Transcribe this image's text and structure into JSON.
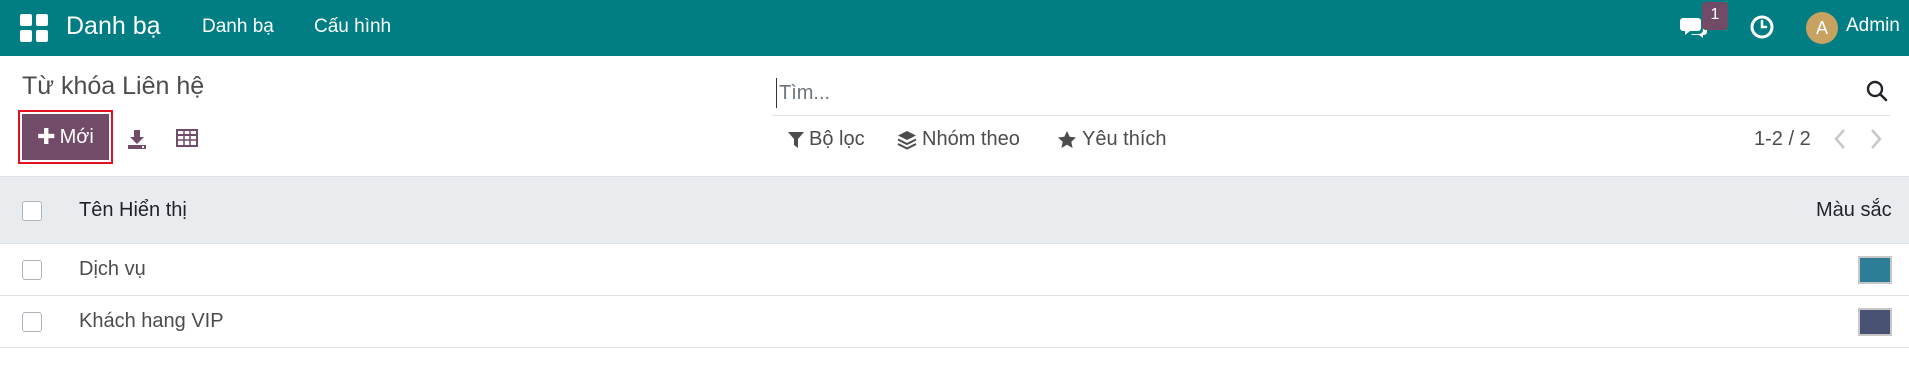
{
  "navbar": {
    "brand": "Danh bạ",
    "menus": [
      "Danh bạ",
      "Cấu hình"
    ],
    "message_count": "1",
    "avatar_letter": "A",
    "user": "Admin",
    "bg_color": "#017e84"
  },
  "control_panel": {
    "title": "Từ khóa Liên hệ",
    "new_label": "Mới",
    "search_placeholder": "Tìm...",
    "filters_label": "Bộ lọc",
    "group_by_label": "Nhóm theo",
    "favorites_label": "Yêu thích",
    "pager": "1-2 / 2",
    "accent": "#714b67"
  },
  "list": {
    "columns": [
      "Tên Hiển thị",
      "Màu sắc"
    ],
    "rows": [
      {
        "name": "Dịch vụ",
        "color": "#2e7d96"
      },
      {
        "name": "Khách hang VIP",
        "color": "#4a5274"
      }
    ]
  }
}
